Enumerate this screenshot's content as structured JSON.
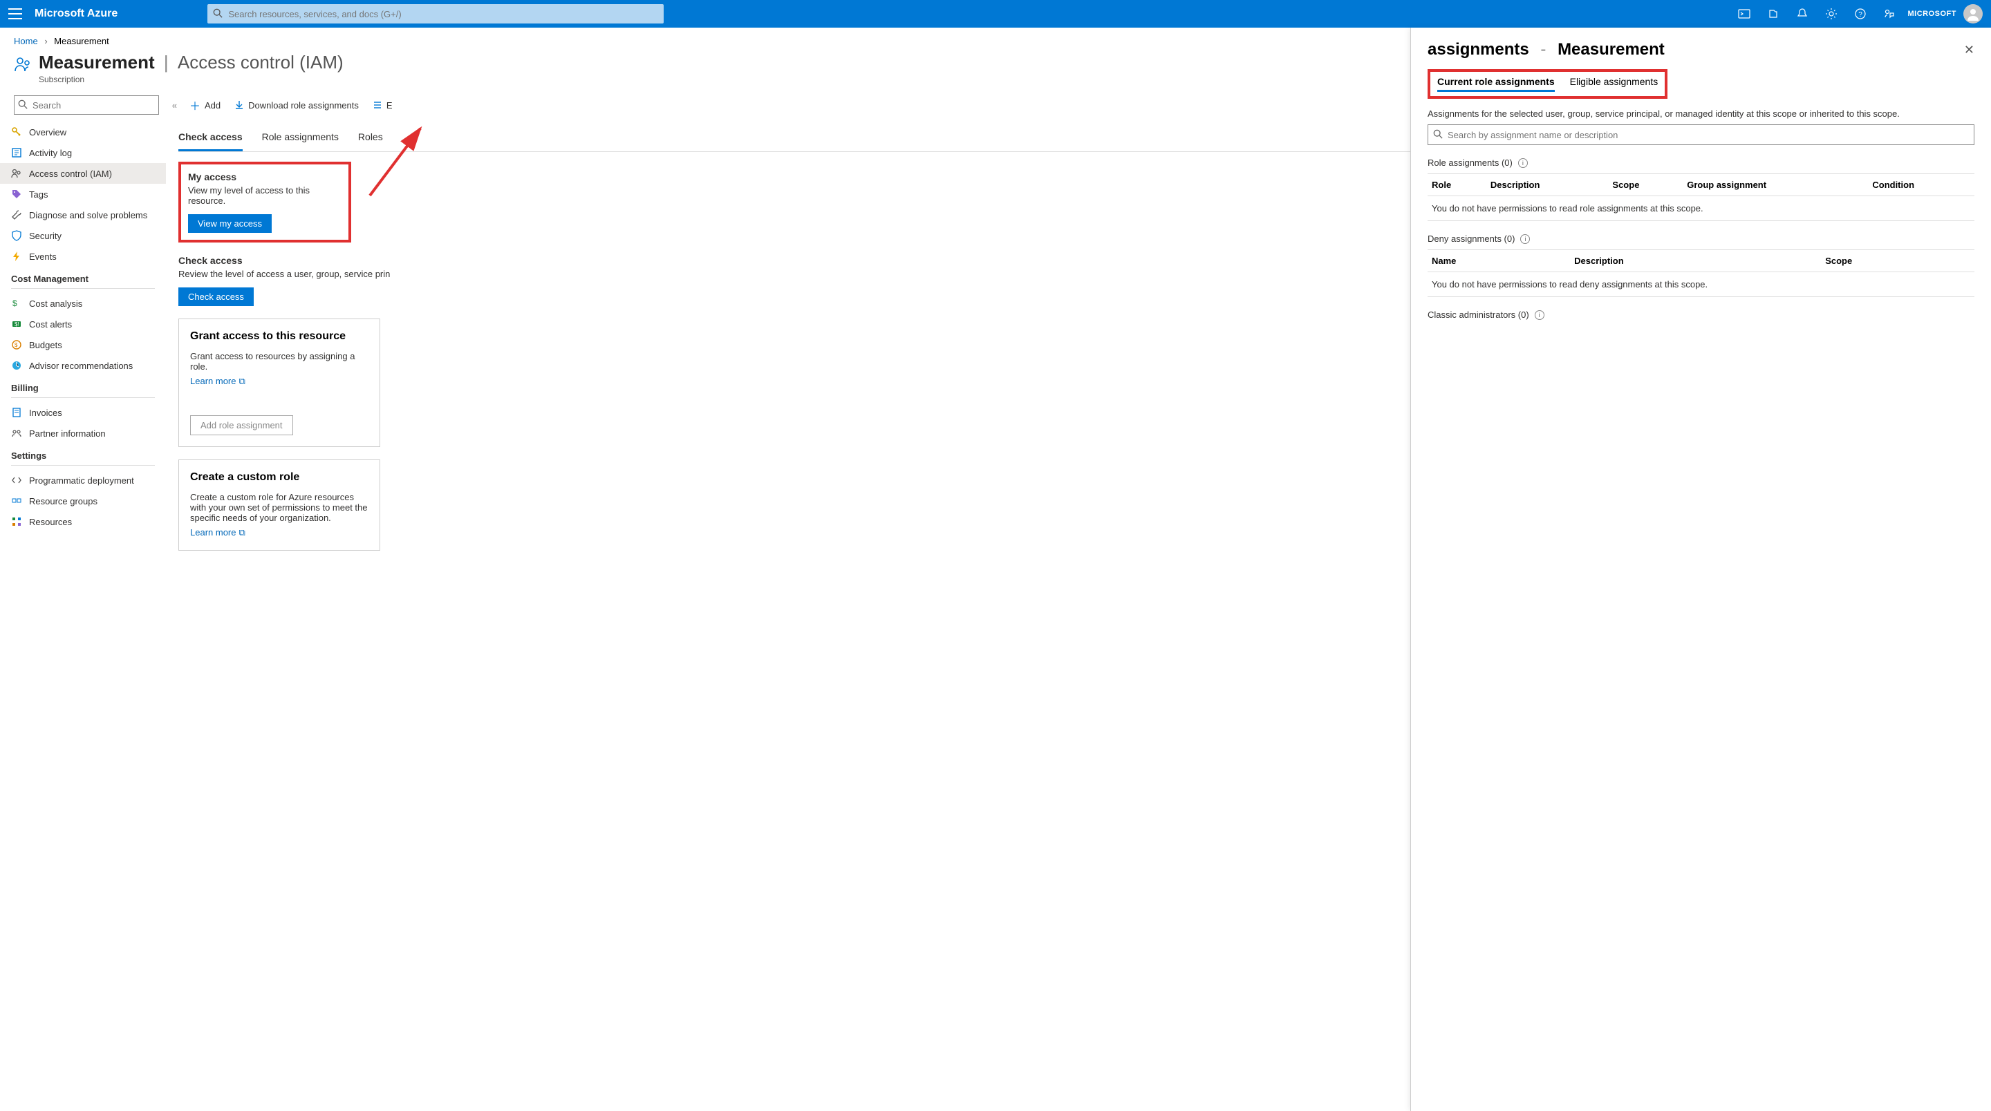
{
  "header": {
    "brand": "Microsoft Azure",
    "search_placeholder": "Search resources, services, and docs (G+/)",
    "tenant": "MICROSOFT"
  },
  "breadcrumb": {
    "home": "Home",
    "current": "Measurement"
  },
  "page": {
    "title": "Measurement",
    "section": "Access control (IAM)",
    "subtitle": "Subscription"
  },
  "toolbar": {
    "add": "Add",
    "download": "Download role assignments",
    "edit_partial": "E"
  },
  "sidebar": {
    "search_placeholder": "Search",
    "items": [
      {
        "label": "Overview",
        "icon": "key"
      },
      {
        "label": "Activity log",
        "icon": "log"
      },
      {
        "label": "Access control (IAM)",
        "icon": "people",
        "active": true
      },
      {
        "label": "Tags",
        "icon": "tag"
      },
      {
        "label": "Diagnose and solve problems",
        "icon": "wrench"
      },
      {
        "label": "Security",
        "icon": "shield"
      },
      {
        "label": "Events",
        "icon": "bolt"
      }
    ],
    "groups": {
      "cost": {
        "label": "Cost Management",
        "items": [
          {
            "label": "Cost analysis",
            "icon": "cost"
          },
          {
            "label": "Cost alerts",
            "icon": "alert"
          },
          {
            "label": "Budgets",
            "icon": "budget"
          },
          {
            "label": "Advisor recommendations",
            "icon": "advisor"
          }
        ]
      },
      "billing": {
        "label": "Billing",
        "items": [
          {
            "label": "Invoices",
            "icon": "invoice"
          },
          {
            "label": "Partner information",
            "icon": "partner"
          }
        ]
      },
      "settings": {
        "label": "Settings",
        "items": [
          {
            "label": "Programmatic deployment",
            "icon": "code"
          },
          {
            "label": "Resource groups",
            "icon": "rg"
          },
          {
            "label": "Resources",
            "icon": "res"
          }
        ]
      }
    }
  },
  "main": {
    "tabs": [
      "Check access",
      "Role assignments",
      "Roles"
    ],
    "my_access": {
      "title": "My access",
      "desc": "View my level of access to this resource.",
      "button": "View my access"
    },
    "check_access": {
      "title": "Check access",
      "desc": "Review the level of access a user, group, service prin",
      "button": "Check access"
    },
    "grant": {
      "title": "Grant access to this resource",
      "desc": "Grant access to resources by assigning a role.",
      "link": "Learn more",
      "button": "Add role assignment"
    },
    "custom": {
      "title": "Create a custom role",
      "desc": "Create a custom role for Azure resources with your own set of permissions to meet the specific needs of your organization.",
      "link": "Learn more"
    }
  },
  "panel": {
    "title_left": "assignments",
    "title_right": "Measurement",
    "tabs": [
      "Current role assignments",
      "Eligible assignments"
    ],
    "hint": "Assignments for the selected user, group, service principal, or managed identity at this scope or inherited to this scope.",
    "search_placeholder": "Search by assignment name or description",
    "role_assignments": {
      "label": "Role assignments (0)",
      "cols": [
        "Role",
        "Description",
        "Scope",
        "Group assignment",
        "Condition"
      ],
      "empty": "You do not have permissions to read role assignments at this scope."
    },
    "deny_assignments": {
      "label": "Deny assignments (0)",
      "cols": [
        "Name",
        "Description",
        "Scope"
      ],
      "empty": "You do not have permissions to read deny assignments at this scope."
    },
    "classic": {
      "label": "Classic administrators (0)"
    }
  }
}
